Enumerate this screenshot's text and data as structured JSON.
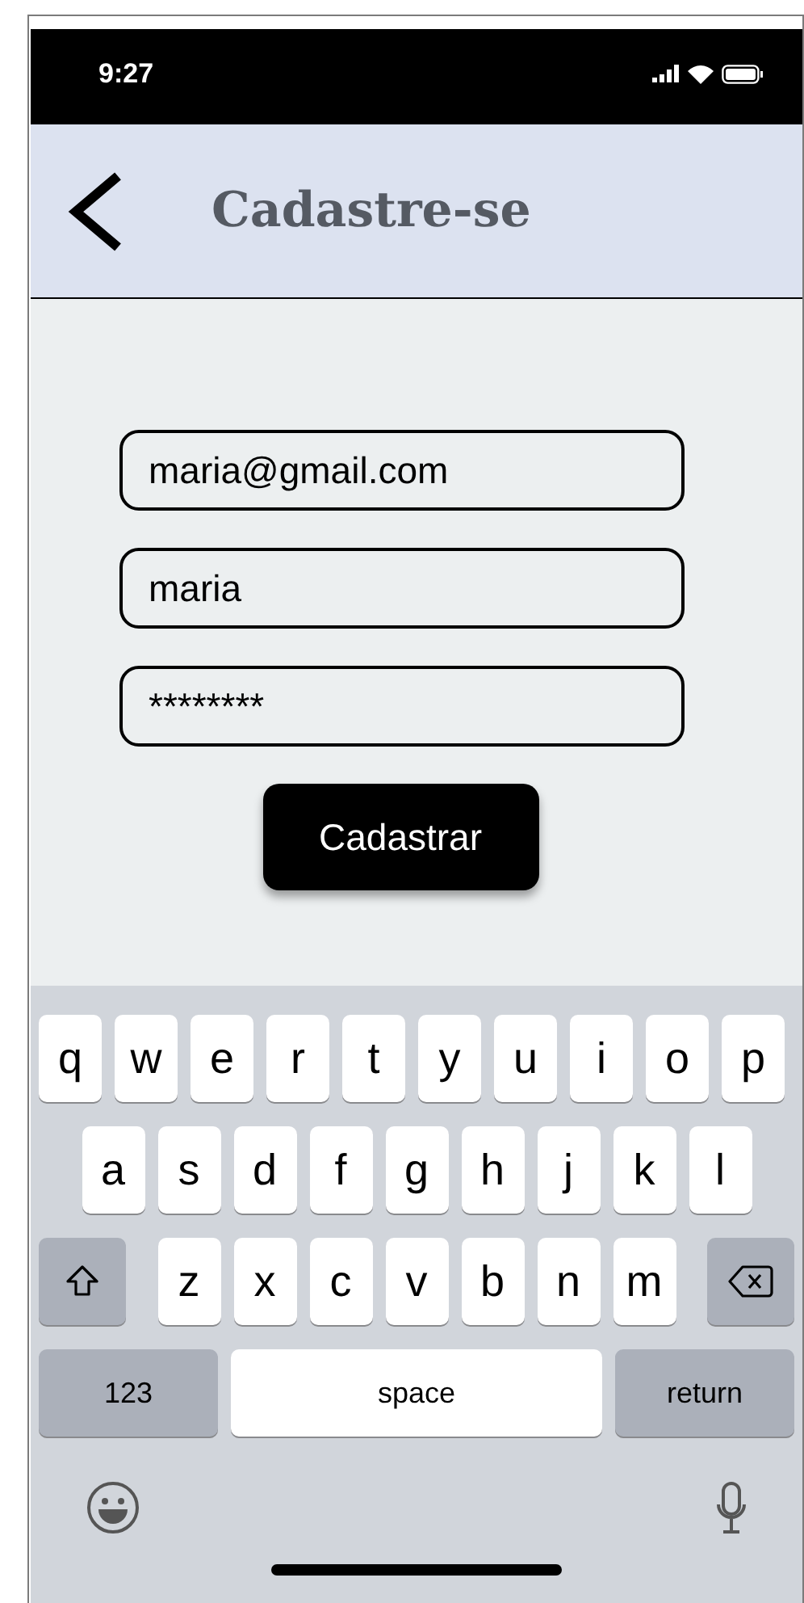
{
  "status_bar": {
    "time": "9:27"
  },
  "header": {
    "title": "Cadastre-se"
  },
  "fields": [
    {
      "value": "maria@gmail.com"
    },
    {
      "value": "maria"
    },
    {
      "value": "********"
    }
  ],
  "submit_button": {
    "label": "Cadastrar"
  },
  "keyboard": {
    "rows": [
      {
        "keys": [
          {
            "kind": "letter",
            "label": "q"
          },
          {
            "kind": "letter",
            "label": "w"
          },
          {
            "kind": "letter",
            "label": "e"
          },
          {
            "kind": "letter",
            "label": "r"
          },
          {
            "kind": "letter",
            "label": "t"
          },
          {
            "kind": "letter",
            "label": "y"
          },
          {
            "kind": "letter",
            "label": "u"
          },
          {
            "kind": "letter",
            "label": "i"
          },
          {
            "kind": "letter",
            "label": "o"
          },
          {
            "kind": "letter",
            "label": "p"
          }
        ]
      },
      {
        "keys": [
          {
            "kind": "letter",
            "label": "a"
          },
          {
            "kind": "letter",
            "label": "s"
          },
          {
            "kind": "letter",
            "label": "d"
          },
          {
            "kind": "letter",
            "label": "f"
          },
          {
            "kind": "letter",
            "label": "g"
          },
          {
            "kind": "letter",
            "label": "h"
          },
          {
            "kind": "letter",
            "label": "j"
          },
          {
            "kind": "letter",
            "label": "k"
          },
          {
            "kind": "letter",
            "label": "l"
          }
        ]
      },
      {
        "keys": [
          {
            "kind": "shift"
          },
          {
            "kind": "letter",
            "label": "z"
          },
          {
            "kind": "letter",
            "label": "x"
          },
          {
            "kind": "letter",
            "label": "c"
          },
          {
            "kind": "letter",
            "label": "v"
          },
          {
            "kind": "letter",
            "label": "b"
          },
          {
            "kind": "letter",
            "label": "n"
          },
          {
            "kind": "letter",
            "label": "m"
          },
          {
            "kind": "delete"
          }
        ]
      },
      {
        "keys": [
          {
            "kind": "mode",
            "label": "123"
          },
          {
            "kind": "space",
            "label": "space"
          },
          {
            "kind": "return",
            "label": "return"
          }
        ]
      }
    ]
  }
}
